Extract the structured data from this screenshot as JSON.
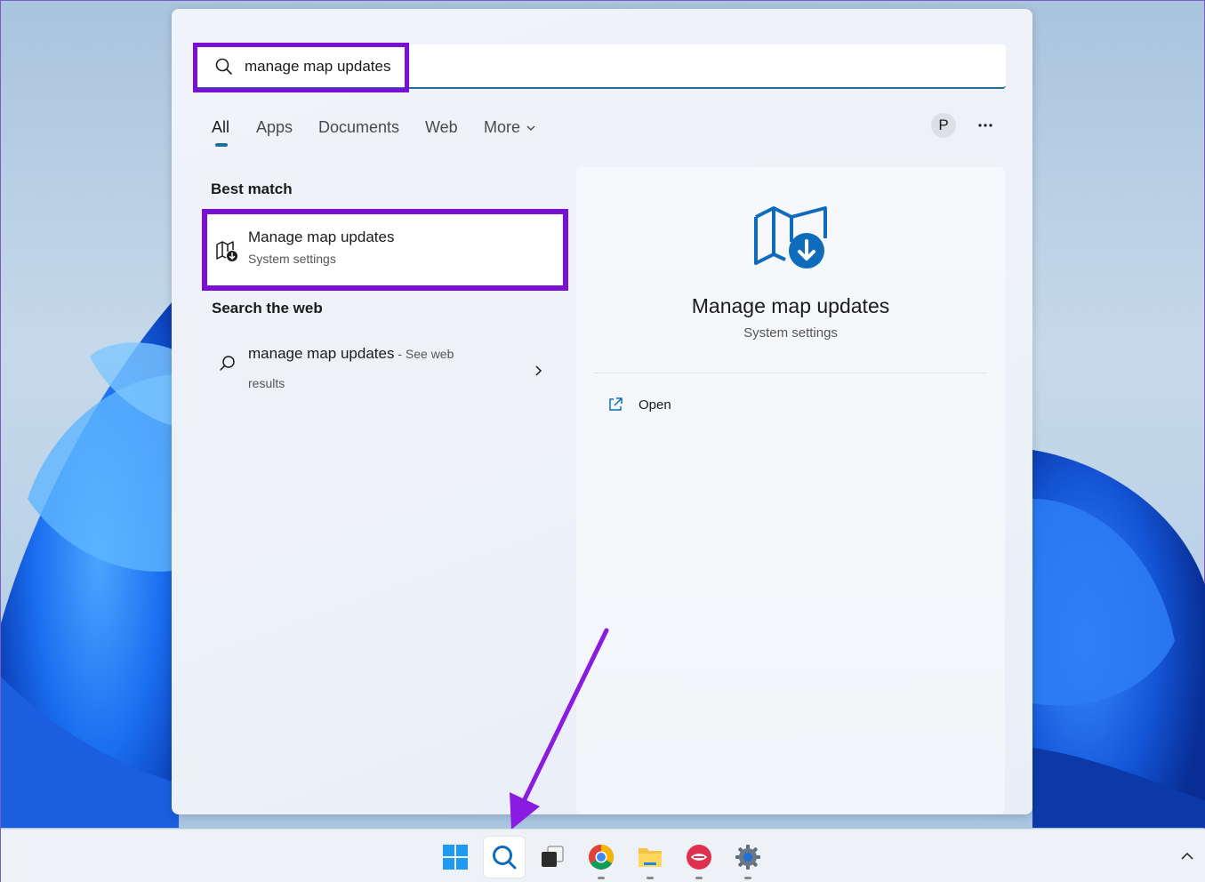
{
  "search": {
    "query": "manage map updates"
  },
  "tabs": [
    {
      "label": "All"
    },
    {
      "label": "Apps"
    },
    {
      "label": "Documents"
    },
    {
      "label": "Web"
    },
    {
      "label": "More"
    }
  ],
  "profile": {
    "initial": "P"
  },
  "best_match": {
    "heading": "Best match",
    "title": "Manage map updates",
    "subtitle": "System settings"
  },
  "web": {
    "heading": "Search the web",
    "query": "manage map updates",
    "suffix": " - See web",
    "line2": "results"
  },
  "detail": {
    "title": "Manage map updates",
    "subtitle": "System settings",
    "open_label": "Open"
  },
  "colors": {
    "accent": "#1f6f9d",
    "highlight": "#7a0fd6",
    "map_icon": "#0f6cbd"
  },
  "taskbar": {
    "apps": [
      "start",
      "search",
      "task-view",
      "chrome",
      "file-explorer",
      "app",
      "settings"
    ]
  }
}
